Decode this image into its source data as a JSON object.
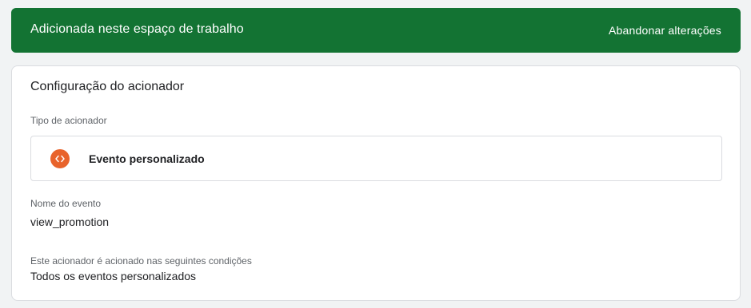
{
  "banner": {
    "title": "Adicionada neste espaço de trabalho",
    "discard_label": "Abandonar alterações",
    "color": "#137333"
  },
  "config": {
    "title": "Configuração do acionador",
    "trigger_type": {
      "label": "Tipo de acionador",
      "value": "Evento personalizado",
      "icon": "code-brackets-icon",
      "icon_color": "#e8632b"
    },
    "event_name": {
      "label": "Nome do evento",
      "value": "view_promotion"
    },
    "conditions": {
      "label": "Este acionador é acionado nas seguintes condições",
      "value": "Todos os eventos personalizados"
    }
  }
}
